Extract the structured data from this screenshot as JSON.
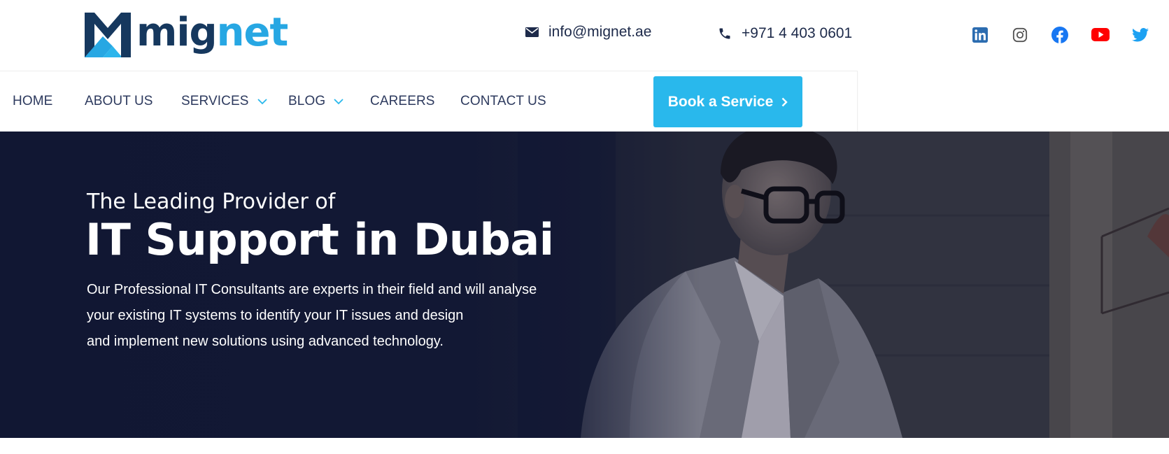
{
  "brand": {
    "name_part1": "mig",
    "name_part2": "net",
    "logo_icon": "mignet-logo-mark",
    "colors": {
      "dark": "#16385e",
      "light": "#27a7e3"
    }
  },
  "contact": {
    "email": "info@mignet.ae",
    "email_icon": "envelope-icon",
    "phone": "+971 4 403 0601",
    "phone_icon": "phone-icon"
  },
  "social": [
    {
      "name": "linkedin-icon",
      "color": "#2c6cb0"
    },
    {
      "name": "instagram-icon",
      "color": "#555555"
    },
    {
      "name": "facebook-icon",
      "color": "#1877f2"
    },
    {
      "name": "youtube-icon",
      "color": "#ff0000"
    },
    {
      "name": "twitter-icon",
      "color": "#1da1f2"
    }
  ],
  "nav": {
    "items": [
      {
        "label": "HOME"
      },
      {
        "label": "ABOUT US"
      },
      {
        "label": "SERVICES",
        "dropdown": true
      },
      {
        "label": "BLOG",
        "dropdown": true
      },
      {
        "label": "CAREERS"
      },
      {
        "label": "CONTACT US"
      }
    ],
    "cta_label": "Book a Service",
    "cta_color": "#29b8ec"
  },
  "hero": {
    "subtitle": "The Leading Provider of",
    "title": "IT Support in Dubai",
    "description_lines": [
      "Our Professional IT Consultants are experts in their field and will analyse",
      "your existing IT systems to identify your IT issues and design",
      "and implement new solutions using advanced technology."
    ],
    "background_color": "#121834"
  }
}
